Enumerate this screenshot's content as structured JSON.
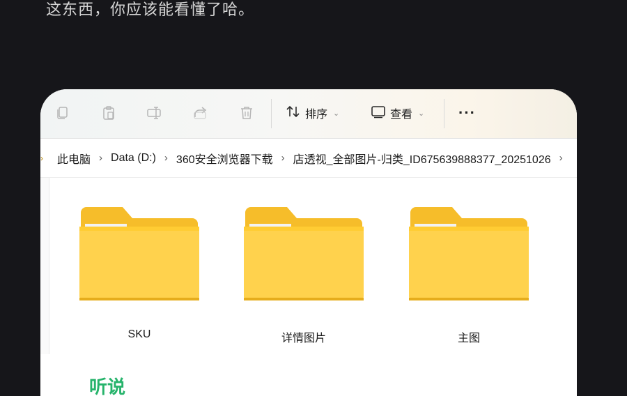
{
  "top_text": "这东西，你应该能看懂了哈。",
  "toolbar": {
    "icons": [
      "copy-icon",
      "paste-icon",
      "rename-icon",
      "share-icon",
      "delete-icon"
    ],
    "sort_label": "排序",
    "view_label": "查看",
    "more_label": "···"
  },
  "breadcrumb": {
    "items": [
      "此电脑",
      "Data (D:)",
      "360安全浏览器下载",
      "店透视_全部图片-归类_ID675639888377_20251026"
    ],
    "separator": "›"
  },
  "folders": [
    {
      "name": "SKU"
    },
    {
      "name": "详情图片"
    },
    {
      "name": "主图"
    }
  ],
  "bottom_text": "听说",
  "colors": {
    "background": "#16161a",
    "folder_yellow": "#ffd24d",
    "accent_green": "#26b36b"
  }
}
